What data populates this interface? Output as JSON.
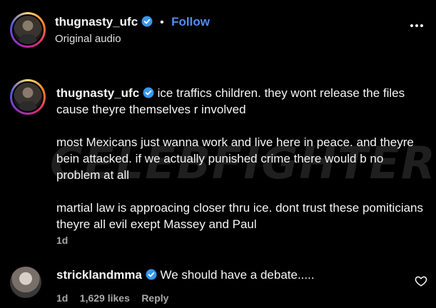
{
  "header": {
    "username": "thugnasty_ufc",
    "separator": "•",
    "follow_label": "Follow",
    "subtitle": "Original audio"
  },
  "main_comment": {
    "username": "thugnasty_ufc",
    "paragraphs": [
      "ice traffics children. they wont release the files cause theyre themselves r involved",
      "most Mexicans just wanna work and live here in peace. and theyre bein attacked. if we actually punished crime there would b no problem at all",
      "martial law is approacing closer thru ice. dont trust these pomiticians theyre all evil exept Massey and Paul"
    ],
    "time": "1d"
  },
  "reply": {
    "username": "stricklandmma",
    "text": "We should have a debate.....",
    "time": "1d",
    "likes": "1,629 likes",
    "reply_label": "Reply"
  },
  "watermark": "CELEBFIGHTER",
  "colors": {
    "background": "#000000",
    "text": "#f5f5f5",
    "muted": "#a8a8a8",
    "follow": "#4f8df7",
    "verified": "#3897f0"
  },
  "icons": [
    "more-icon",
    "verified-badge-icon",
    "heart-icon"
  ]
}
